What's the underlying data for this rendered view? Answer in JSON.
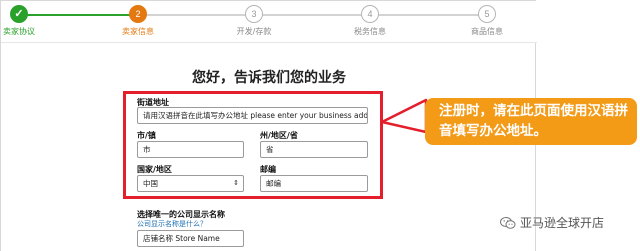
{
  "steps": [
    {
      "number": "✓",
      "label": "卖家协议",
      "state": "done"
    },
    {
      "number": "2",
      "label": "卖家信息",
      "state": "active"
    },
    {
      "number": "3",
      "label": "开发/存款",
      "state": "todo"
    },
    {
      "number": "4",
      "label": "税务信息",
      "state": "todo"
    },
    {
      "number": "5",
      "label": "商品信息",
      "state": "todo"
    }
  ],
  "page_title": "您好，告诉我们您的业务",
  "form": {
    "street": {
      "label": "街道地址",
      "value": "请用汉语拼音在此填写办公地址 please enter your business address"
    },
    "city": {
      "label": "市/镇",
      "value": "市"
    },
    "state": {
      "label": "州/地区/省",
      "value": "省"
    },
    "country": {
      "label": "国家/地区",
      "value": "中国"
    },
    "zip": {
      "label": "邮编",
      "value": "邮编"
    },
    "store_name": {
      "label": "选择唯一的公司显示名称",
      "link": "公司显示名称是什么？",
      "value": "店铺名称 Store Name"
    }
  },
  "callout": {
    "text": "注册时，请在此页面使用汉语拼音填写办公地址。"
  },
  "watermark": {
    "text": "亚马逊全球开店"
  },
  "colors": {
    "brand_orange": "#e47911",
    "success_green": "#2aa12a",
    "highlight_red": "#e41e2b",
    "callout_orange": "#f39a17"
  }
}
